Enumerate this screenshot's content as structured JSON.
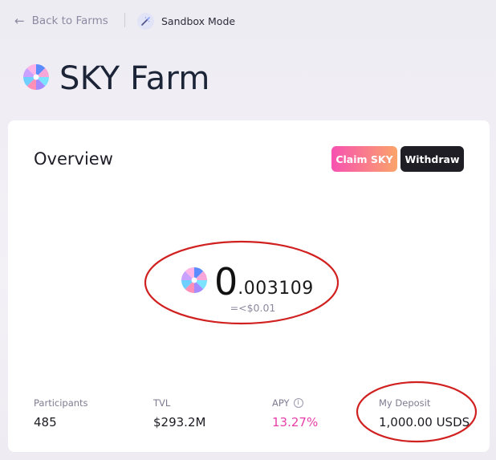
{
  "nav": {
    "back_label": "Back to Farms",
    "sandbox_label": "Sandbox Mode"
  },
  "page": {
    "title": "SKY Farm"
  },
  "overview": {
    "heading": "Overview",
    "claim_label": "Claim SKY",
    "withdraw_label": "Withdraw",
    "balance_int": "0",
    "balance_dec": ".003109",
    "usd_value": "=<$0.01"
  },
  "stats": [
    {
      "label": "Participants",
      "value": "485"
    },
    {
      "label": "TVL",
      "value": "$293.2M"
    },
    {
      "label": "APY",
      "value": "13.27%"
    },
    {
      "label": "My Deposit",
      "value": "1,000.00 USDS"
    }
  ],
  "colors": {
    "apy": "#e83ea8",
    "claim_gradient_start": "#f752b1",
    "claim_gradient_end": "#fba46a",
    "annotation_ring": "#d12020"
  },
  "icons": [
    "arrow-left-icon",
    "magic-wand-icon",
    "sky-token-icon",
    "info-icon"
  ]
}
